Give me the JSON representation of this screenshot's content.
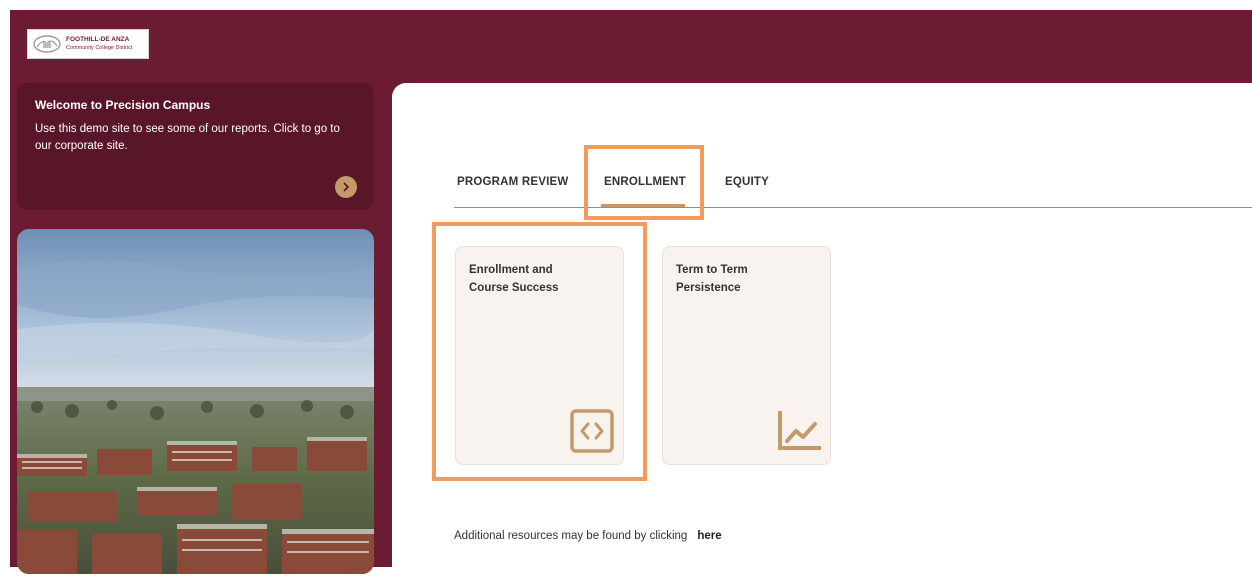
{
  "header": {
    "logo": {
      "line1": "FOOTHILL-DE ANZA",
      "line2": "Community College District"
    }
  },
  "sidebar": {
    "welcome": {
      "title": "Welcome to Precision Campus",
      "body": "Use this demo site to see some of our reports. Click to go to our corporate site.",
      "arrow_icon": "chevron-right-icon"
    },
    "photo": {
      "subject": "aerial campus photo"
    }
  },
  "main": {
    "tabs": [
      {
        "label": "PROGRAM REVIEW",
        "active": false
      },
      {
        "label": "ENROLLMENT",
        "active": true
      },
      {
        "label": "EQUITY",
        "active": false
      }
    ],
    "cards": [
      {
        "title": "Enrollment and Course Success",
        "icon": "code-brackets-icon"
      },
      {
        "title": "Term to Term Persistence",
        "icon": "line-chart-icon"
      }
    ],
    "footer": {
      "text": "Additional resources may be found by clicking",
      "link": "here"
    }
  },
  "colors": {
    "brand_maroon": "#6c1c32",
    "panel_maroon": "#5a1629",
    "accent_gold": "#c59a6a",
    "highlight_orange": "#f59a5c",
    "card_bg": "#f8f3ee"
  }
}
